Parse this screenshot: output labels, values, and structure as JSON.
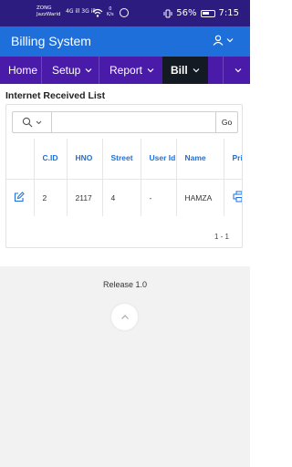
{
  "status_bar": {
    "carrier_line1": "ZONG",
    "carrier_line2": "JazzWarid",
    "signal": "4G ill 3G ill",
    "speed_value": "0",
    "speed_unit": "K/s",
    "battery_percent": "56%",
    "time": "7:15"
  },
  "app": {
    "title": "Billing System",
    "user_icon": "user-icon"
  },
  "nav": {
    "items": [
      {
        "label": "Home"
      },
      {
        "label": "Setup"
      },
      {
        "label": "Report"
      },
      {
        "label": "Bill"
      }
    ]
  },
  "page": {
    "title": "Internet Received List"
  },
  "search": {
    "value": "",
    "go_label": "Go"
  },
  "table": {
    "headers": [
      "",
      "C.ID",
      "HNO",
      "Street",
      "User Id",
      "Name",
      "Pri"
    ],
    "rows": [
      {
        "cid": "2",
        "hno": "2117",
        "street": "4",
        "user_id": "-",
        "name": "HAMZA"
      }
    ]
  },
  "pagination": "1 - 1",
  "footer": {
    "release": "Release 1.0"
  },
  "colors": {
    "status_bar": "#2c1c80",
    "app_bar": "#1e6fd9",
    "nav_bar": "#4a1aa8",
    "nav_active": "#141a24",
    "header_text": "#1e6fd9"
  }
}
